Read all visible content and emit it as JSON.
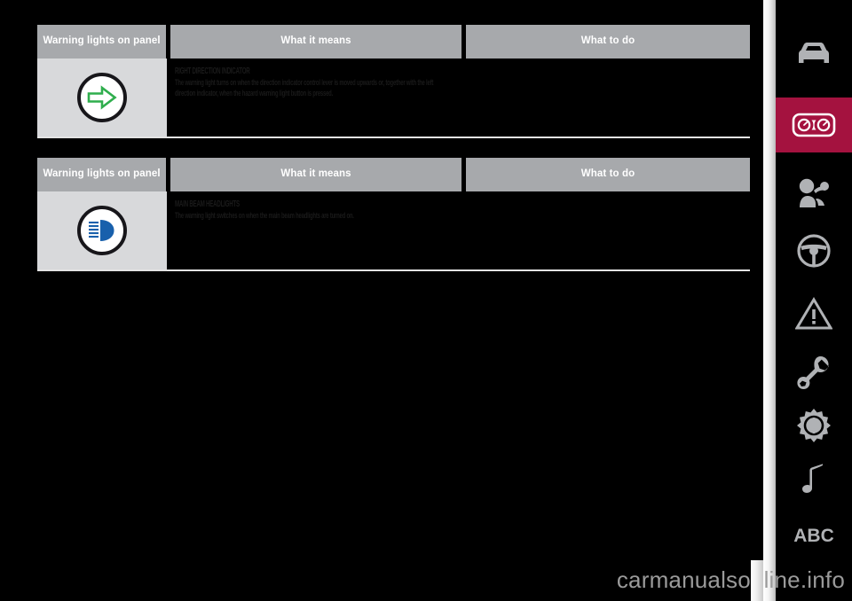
{
  "document": {
    "background_color": "#000000",
    "accent_color": "#a4123f",
    "header_bg": "#a7a9ac",
    "symbol_cell_bg": "#d8d9db"
  },
  "tables": [
    {
      "headers": {
        "symbol": "Warning lights on panel",
        "means": "What it means",
        "todo": "What to do"
      },
      "row": {
        "symbol_name": "right-direction-indicator-icon",
        "symbol_color": "#2fae4d",
        "title": "RIGHT DIRECTION INDICATOR",
        "body": "The warning light turns on when the direction indicator control lever is moved upwards or, together with the left direction indicator, when the hazard warning light button is pressed.",
        "todo": ""
      }
    },
    {
      "headers": {
        "symbol": "Warning lights on panel",
        "means": "What it means",
        "todo": "What to do"
      },
      "row": {
        "symbol_name": "main-beam-headlights-icon",
        "symbol_color": "#1860ac",
        "title": "MAIN BEAM HEADLIGHTS",
        "body": "The warning light switches on when the main beam headlights are turned on.",
        "todo": ""
      }
    }
  ],
  "sidebar": {
    "items": [
      {
        "icon": "car-front-icon",
        "label": "Dashboard and controls",
        "active": false
      },
      {
        "icon": "instrument-panel-icon",
        "label": "Warning lights and messages",
        "active": true
      },
      {
        "icon": "airbag-passenger-icon",
        "label": "Safety",
        "active": false
      },
      {
        "icon": "steering-wheel-icon",
        "label": "Starting and driving",
        "active": false
      },
      {
        "icon": "warning-triangle-icon",
        "label": "In an emergency",
        "active": false
      },
      {
        "icon": "wrench-icon",
        "label": "Maintenance and care",
        "active": false
      },
      {
        "icon": "gear-icon",
        "label": "Technical specifications",
        "active": false
      },
      {
        "icon": "music-note-icon",
        "label": "Multimedia",
        "active": false
      },
      {
        "icon": "abc-index",
        "label": "ABC",
        "active": false
      }
    ]
  },
  "watermark": {
    "text": "carmanualsonline.info"
  }
}
